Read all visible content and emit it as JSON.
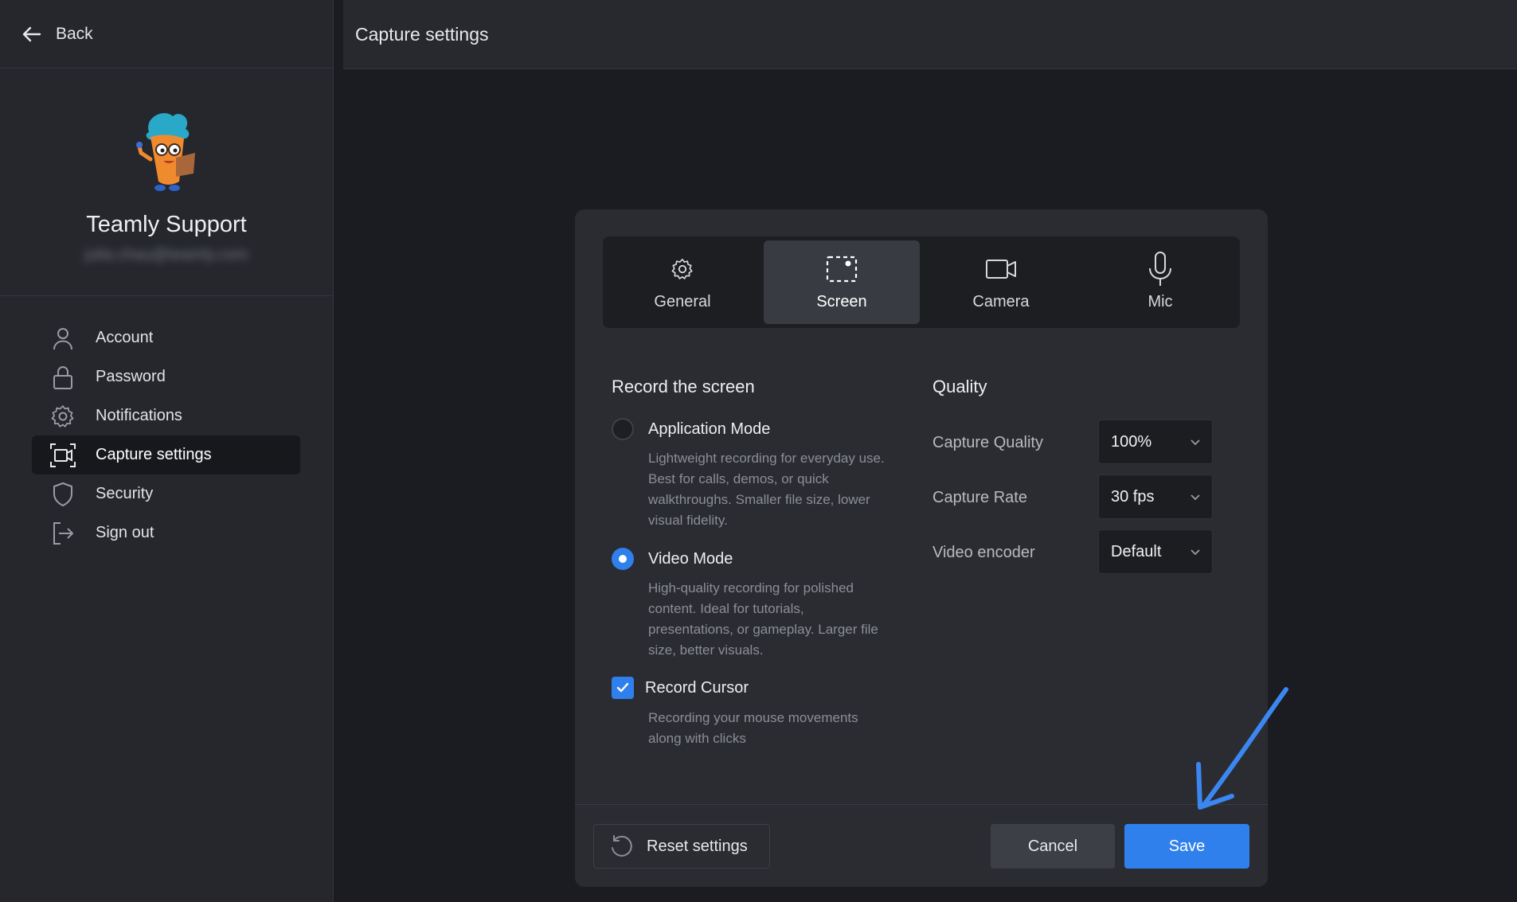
{
  "sidebar": {
    "back_label": "Back",
    "profile": {
      "name": "Teamly Support",
      "email": "julia.chau@teamly.com"
    },
    "items": [
      {
        "label": "Account",
        "icon": "user-icon",
        "active": false
      },
      {
        "label": "Password",
        "icon": "lock-icon",
        "active": false
      },
      {
        "label": "Notifications",
        "icon": "gear-icon",
        "active": false
      },
      {
        "label": "Capture settings",
        "icon": "capture-icon",
        "active": true
      },
      {
        "label": "Security",
        "icon": "shield-icon",
        "active": false
      },
      {
        "label": "Sign out",
        "icon": "sign-out-icon",
        "active": false
      }
    ]
  },
  "main": {
    "title": "Capture settings"
  },
  "dialog": {
    "tabs": [
      {
        "label": "General",
        "icon": "gear-icon",
        "active": false
      },
      {
        "label": "Screen",
        "icon": "screen-select-icon",
        "active": true
      },
      {
        "label": "Camera",
        "icon": "camera-icon",
        "active": false
      },
      {
        "label": "Mic",
        "icon": "microphone-icon",
        "active": false
      }
    ],
    "record": {
      "title": "Record the screen",
      "app_mode": {
        "label": "Application Mode",
        "lines": [
          "Lightweight recording for everyday use.",
          "Best for calls, demos, or quick",
          "walkthroughs. Smaller file size, lower",
          "visual fidelity."
        ],
        "selected": false
      },
      "video_mode": {
        "label": "Video Mode",
        "lines": [
          "High-quality recording for polished",
          "content. Ideal for tutorials,",
          "presentations, or gameplay. Larger file",
          "size, better visuals."
        ],
        "selected": true
      },
      "cursor": {
        "label": "Record Cursor",
        "lines": [
          "Recording your mouse movements",
          "along with clicks"
        ],
        "checked": true
      }
    },
    "quality": {
      "title": "Quality",
      "capture_quality": {
        "label": "Capture Quality",
        "value": "100%"
      },
      "capture_rate": {
        "label": "Capture Rate",
        "value": "30 fps"
      },
      "video_encoder": {
        "label": "Video encoder",
        "value": "Default"
      }
    },
    "footer": {
      "reset_label": "Reset settings",
      "cancel_label": "Cancel",
      "save_label": "Save"
    }
  },
  "colors": {
    "accent": "#2f80ed",
    "background": "#1b1c21",
    "panel": "#2a2c32",
    "annotation_arrow": "#3b86f0"
  }
}
